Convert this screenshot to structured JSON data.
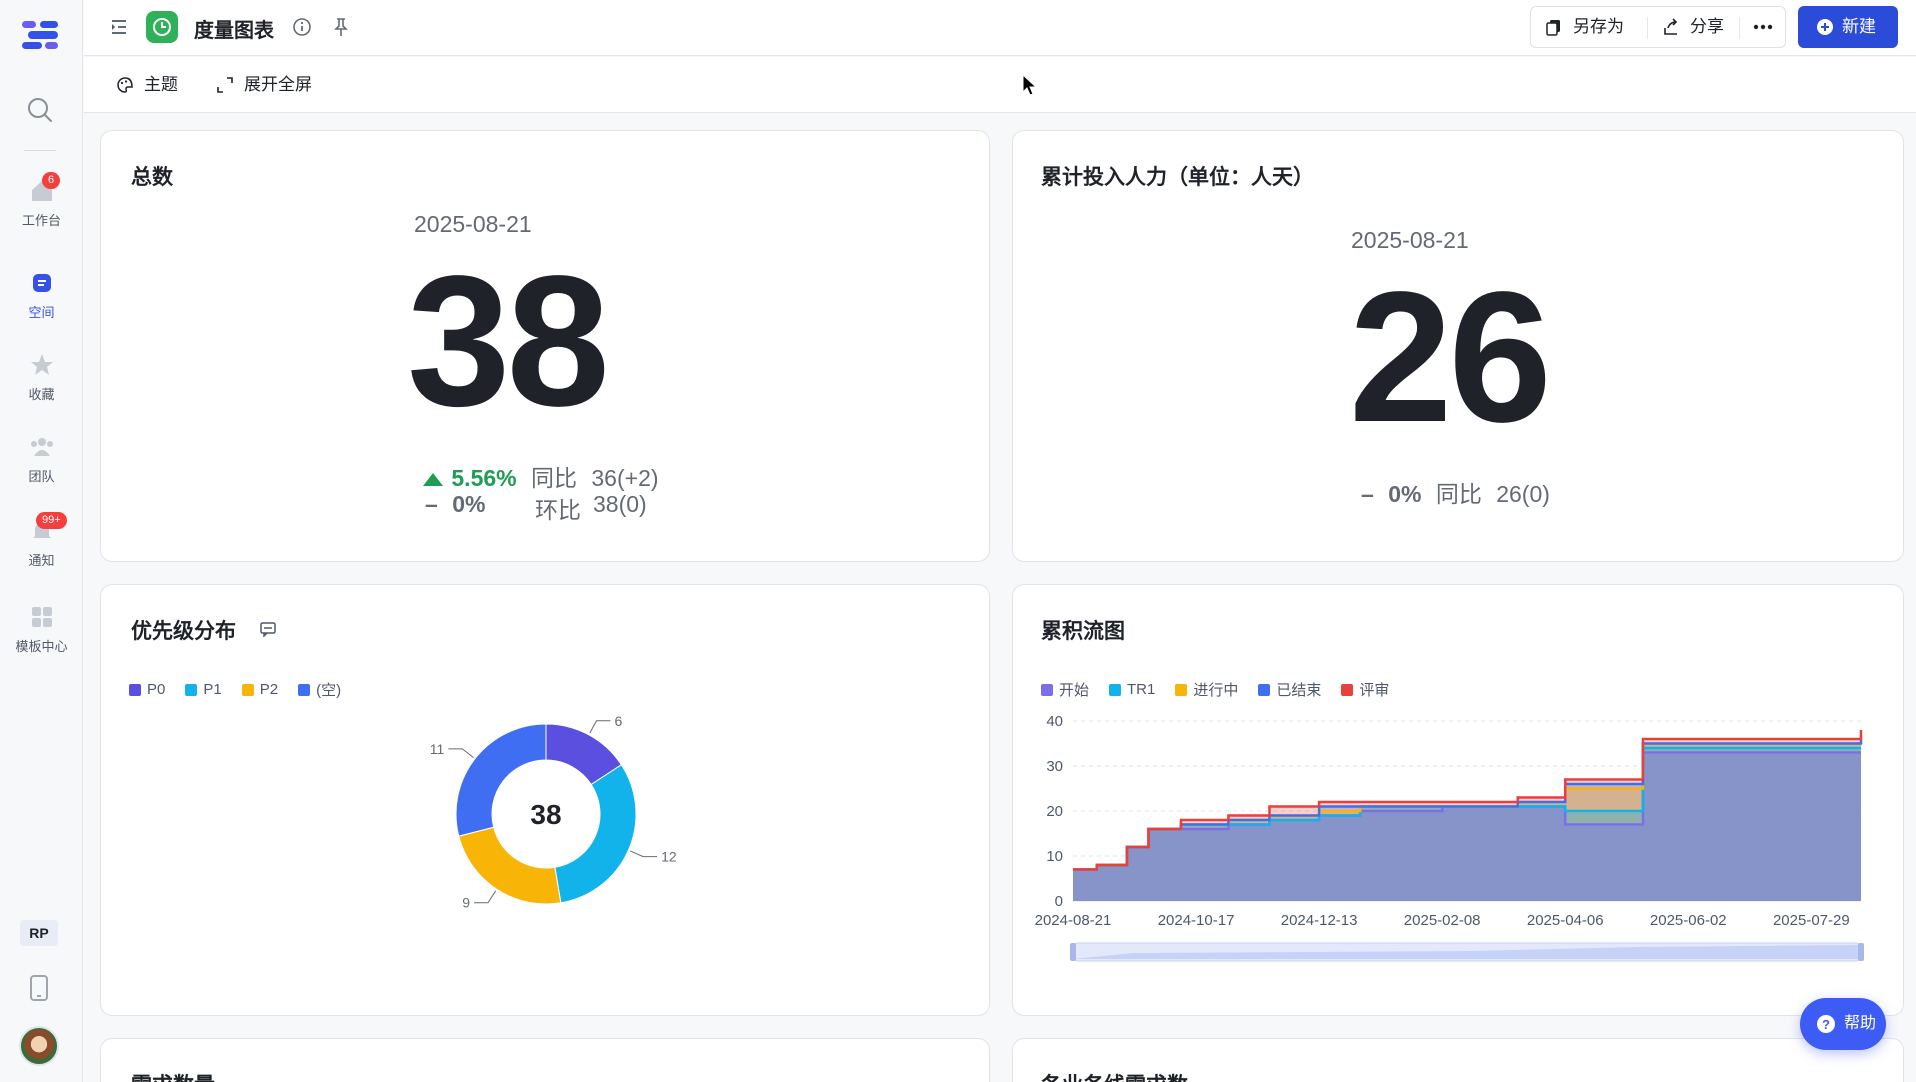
{
  "sidebar": {
    "items": [
      {
        "label": "工作台",
        "badge": "6",
        "icon": "home-icon"
      },
      {
        "label": "空间",
        "icon": "space-icon",
        "active": true
      },
      {
        "label": "收藏",
        "icon": "star-icon"
      },
      {
        "label": "团队",
        "icon": "team-icon"
      },
      {
        "label": "通知",
        "badge": "99+",
        "icon": "bell-icon"
      },
      {
        "label": "模板中心",
        "icon": "template-icon"
      }
    ],
    "user_initials": "RP"
  },
  "topbar": {
    "title": "度量图表",
    "save_as": "另存为",
    "share": "分享",
    "new": "新建"
  },
  "subbar": {
    "theme": "主题",
    "fullscreen": "展开全屏"
  },
  "cards": {
    "total": {
      "title": "总数",
      "date": "2025-08-21",
      "value": "38",
      "yoy_pct": "5.56%",
      "yoy_label": "同比",
      "yoy_value": "36(+2)",
      "mom_pct": "0%",
      "mom_label": "环比",
      "mom_value": "38(0)"
    },
    "effort": {
      "title": "累计投入人力（单位：人天）",
      "date": "2025-08-21",
      "value": "26",
      "yoy_pct": "0%",
      "yoy_label": "同比",
      "yoy_value": "26(0)"
    },
    "priority": {
      "title": "优先级分布",
      "center_value": "38"
    },
    "cfd": {
      "title": "累积流图"
    },
    "bottom_left": {
      "title": "需求数量"
    },
    "bottom_right": {
      "title": "各业务线需求数"
    }
  },
  "help": {
    "label": "帮助"
  },
  "colors": {
    "accent": "#2b4bd9",
    "p0": "#5b4fe0",
    "p1": "#11b3ea",
    "p2": "#f9b408",
    "empty": "#3f6ef2",
    "up": "#1f9d55",
    "review": "#e8403a"
  },
  "chart_data": [
    {
      "type": "pie",
      "variant": "donut",
      "title": "优先级分布",
      "categories": [
        "P0",
        "P1",
        "P2",
        "(空)"
      ],
      "values": [
        6,
        12,
        9,
        11
      ],
      "colors": [
        "#5b4fe0",
        "#11b3ea",
        "#f9b408",
        "#3f6ef2"
      ],
      "total": 38,
      "legend": "top-left"
    },
    {
      "type": "area",
      "title": "累积流图",
      "x_ticks": [
        "2024-08-21",
        "2024-10-17",
        "2024-12-13",
        "2025-02-08",
        "2025-04-06",
        "2025-06-02",
        "2025-07-29"
      ],
      "ylim": [
        0,
        40
      ],
      "y_ticks": [
        0,
        10,
        20,
        30,
        40
      ],
      "legend": "top-left",
      "series": [
        {
          "name": "开始",
          "color": "#7b6fe8",
          "points": [
            [
              "2024-08-21",
              7
            ],
            [
              "2024-09-01",
              8
            ],
            [
              "2024-09-15",
              12
            ],
            [
              "2024-09-25",
              16
            ],
            [
              "2024-10-17",
              16
            ],
            [
              "2024-11-01",
              17
            ],
            [
              "2024-11-20",
              18
            ],
            [
              "2024-12-13",
              19
            ],
            [
              "2025-01-01",
              20
            ],
            [
              "2025-02-08",
              21
            ],
            [
              "2025-03-15",
              21
            ],
            [
              "2025-04-06",
              17
            ],
            [
              "2025-05-10",
              17
            ],
            [
              "2025-05-12",
              33
            ],
            [
              "2025-08-21",
              33
            ]
          ]
        },
        {
          "name": "TR1",
          "color": "#11b3ea",
          "points": [
            [
              "2024-08-21",
              7
            ],
            [
              "2024-09-01",
              8
            ],
            [
              "2024-09-15",
              12
            ],
            [
              "2024-09-25",
              16
            ],
            [
              "2024-10-10",
              17
            ],
            [
              "2024-11-01",
              17
            ],
            [
              "2024-11-20",
              18
            ],
            [
              "2024-12-13",
              19
            ],
            [
              "2025-01-01",
              21
            ],
            [
              "2025-02-08",
              21
            ],
            [
              "2025-03-15",
              21
            ],
            [
              "2025-04-06",
              20
            ],
            [
              "2025-05-10",
              20
            ],
            [
              "2025-05-12",
              34
            ],
            [
              "2025-08-21",
              34
            ]
          ]
        },
        {
          "name": "进行中",
          "color": "#f9b408",
          "points": [
            [
              "2024-08-21",
              7
            ],
            [
              "2024-09-01",
              8
            ],
            [
              "2024-09-15",
              12
            ],
            [
              "2024-09-25",
              16
            ],
            [
              "2024-10-10",
              17
            ],
            [
              "2024-11-01",
              18
            ],
            [
              "2024-11-20",
              19
            ],
            [
              "2024-12-13",
              20
            ],
            [
              "2025-01-01",
              21
            ],
            [
              "2025-02-08",
              21
            ],
            [
              "2025-03-15",
              22
            ],
            [
              "2025-04-06",
              25
            ],
            [
              "2025-05-10",
              25
            ],
            [
              "2025-05-12",
              35
            ],
            [
              "2025-08-21",
              35
            ]
          ]
        },
        {
          "name": "已结束",
          "color": "#3f6ef2",
          "points": [
            [
              "2024-08-21",
              7
            ],
            [
              "2024-09-01",
              8
            ],
            [
              "2024-09-15",
              12
            ],
            [
              "2024-09-25",
              16
            ],
            [
              "2024-10-10",
              17
            ],
            [
              "2024-11-01",
              18
            ],
            [
              "2024-11-20",
              19
            ],
            [
              "2024-12-13",
              21
            ],
            [
              "2025-01-01",
              21
            ],
            [
              "2025-02-08",
              21
            ],
            [
              "2025-03-15",
              22
            ],
            [
              "2025-04-06",
              26
            ],
            [
              "2025-05-10",
              26
            ],
            [
              "2025-05-12",
              35
            ],
            [
              "2025-08-21",
              36
            ]
          ]
        },
        {
          "name": "评审",
          "color": "#e8403a",
          "points": [
            [
              "2024-08-21",
              7
            ],
            [
              "2024-09-01",
              8
            ],
            [
              "2024-09-15",
              12
            ],
            [
              "2024-09-25",
              16
            ],
            [
              "2024-10-10",
              18
            ],
            [
              "2024-11-01",
              19
            ],
            [
              "2024-11-20",
              21
            ],
            [
              "2024-12-13",
              22
            ],
            [
              "2025-01-01",
              22
            ],
            [
              "2025-02-08",
              22
            ],
            [
              "2025-03-15",
              23
            ],
            [
              "2025-04-06",
              27
            ],
            [
              "2025-05-10",
              27
            ],
            [
              "2025-05-12",
              36
            ],
            [
              "2025-08-20",
              36
            ],
            [
              "2025-08-21",
              38
            ]
          ]
        }
      ]
    }
  ]
}
